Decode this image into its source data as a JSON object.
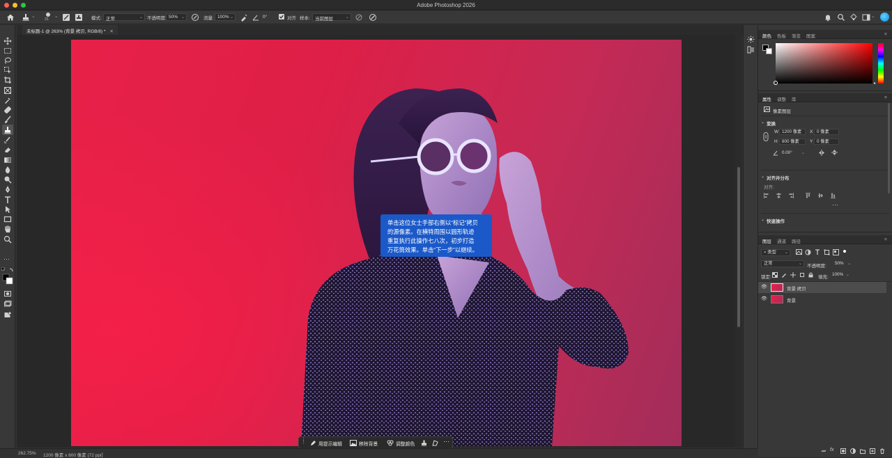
{
  "app": {
    "title": "Adobe Photoshop 2026"
  },
  "colors": {
    "accent": "#1b59c8",
    "canvas_bg": "#e82048",
    "panel_bg": "#383838"
  },
  "options_bar": {
    "brush_size": "21",
    "mode_label": "模式:",
    "mode_value": "正常",
    "opacity_label": "不透明度:",
    "opacity_value": "50%",
    "flow_label": "流量:",
    "flow_value": "100%",
    "angle_value": "0°",
    "align_label": "对齐",
    "sample_label": "样本:",
    "sample_value": "当前图层"
  },
  "document": {
    "tab_title": "未标题-1 @ 263% (背景 拷贝, RGB/8) *"
  },
  "coach_mark": {
    "line1": "单击这位女士手部右侧以“标记”拷贝",
    "line2": "的源像素。在横特周围以圆形轨迹",
    "line3": "重复执行此操作七八次，初步打造",
    "line4": "万花筒效果。单击“下一步”以继续。"
  },
  "context_bar": {
    "prompt_edit": "用提示编辑",
    "remove_bg": "移除背景",
    "adjust_color": "调整颜色"
  },
  "status": {
    "zoom": "262.75%",
    "doc_info": "1200 像素 x 800 像素 (72 ppi)"
  },
  "color_panel": {
    "tabs": [
      "颜色",
      "色板",
      "渐变",
      "图案"
    ]
  },
  "properties_panel": {
    "tabs": [
      "属性",
      "调整",
      "库"
    ],
    "layer_type": "像素图层",
    "transform_title": "变换",
    "w_label": "W",
    "w_value": "1200 像素",
    "h_label": "H",
    "h_value": "800 像素",
    "x_label": "X",
    "x_value": "0 像素",
    "y_label": "Y",
    "y_value": "0 像素",
    "angle_value": "0.00°",
    "align_title": "对齐并分布",
    "align_label": "对齐:",
    "quick_title": "快速操作"
  },
  "layers_panel": {
    "tabs": [
      "图层",
      "通道",
      "路径"
    ],
    "filter_kind": "类型",
    "blend_mode": "正常",
    "opacity_label": "不透明度:",
    "opacity_value": "50%",
    "lock_label": "锁定:",
    "fill_label": "填充:",
    "fill_value": "100%",
    "layers": [
      {
        "name": "背景 拷贝",
        "selected": true
      },
      {
        "name": "背景",
        "selected": false
      }
    ]
  }
}
